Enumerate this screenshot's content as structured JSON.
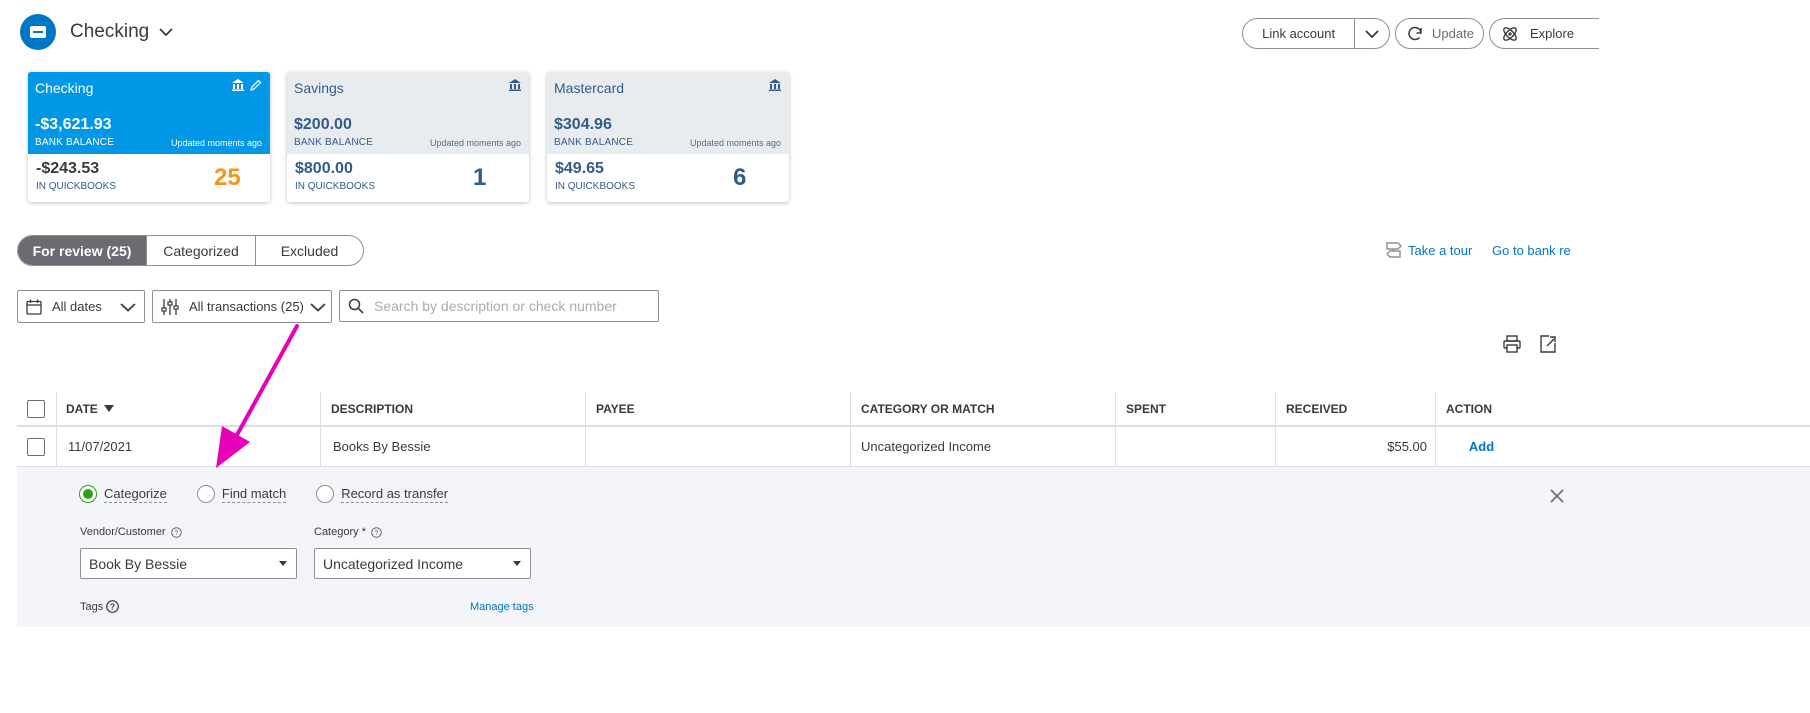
{
  "header": {
    "title": "Checking"
  },
  "top_buttons": {
    "link_account": "Link account",
    "update": "Update",
    "explore": "Explore"
  },
  "cards": [
    {
      "name": "Checking",
      "bank_balance": "-$3,621.93",
      "bank_label": "BANK BALANCE",
      "updated": "Updated moments ago",
      "qb_balance": "-$243.53",
      "qb_label": "IN QUICKBOOKS",
      "count": "25"
    },
    {
      "name": "Savings",
      "bank_balance": "$200.00",
      "bank_label": "BANK BALANCE",
      "updated": "Updated moments ago",
      "qb_balance": "$800.00",
      "qb_label": "IN QUICKBOOKS",
      "count": "1"
    },
    {
      "name": "Mastercard",
      "bank_balance": "$304.96",
      "bank_label": "BANK BALANCE",
      "updated": "Updated moments ago",
      "qb_balance": "$49.65",
      "qb_label": "IN QUICKBOOKS",
      "count": "6"
    }
  ],
  "tabs": [
    {
      "label": "For review (25)"
    },
    {
      "label": "Categorized"
    },
    {
      "label": "Excluded"
    }
  ],
  "links": {
    "take_tour": "Take a tour",
    "go_to_bank": "Go to bank re"
  },
  "filters": {
    "dates": "All dates",
    "transactions": "All transactions (25)",
    "search_placeholder": "Search by description or check number"
  },
  "table": {
    "columns": [
      "DATE",
      "DESCRIPTION",
      "PAYEE",
      "CATEGORY OR MATCH",
      "SPENT",
      "RECEIVED",
      "ACTION"
    ],
    "rows": [
      {
        "date": "11/07/2021",
        "description": "Books By Bessie",
        "payee": "",
        "category": "Uncategorized Income",
        "spent": "",
        "received": "$55.00",
        "action": "Add"
      }
    ]
  },
  "panel": {
    "radios": [
      "Categorize",
      "Find match",
      "Record as transfer"
    ],
    "vendor_label": "Vendor/Customer",
    "vendor_value": "Book By Bessie",
    "category_label": "Category *",
    "category_value": "Uncategorized Income",
    "tags_label": "Tags",
    "manage_tags": "Manage tags"
  },
  "colors": {
    "brand_blue": "#0077c5",
    "card_active": "#0097e6",
    "count_orange": "#f7931e",
    "green": "#2ca01c",
    "annotation_arrow": "#e600b8"
  }
}
